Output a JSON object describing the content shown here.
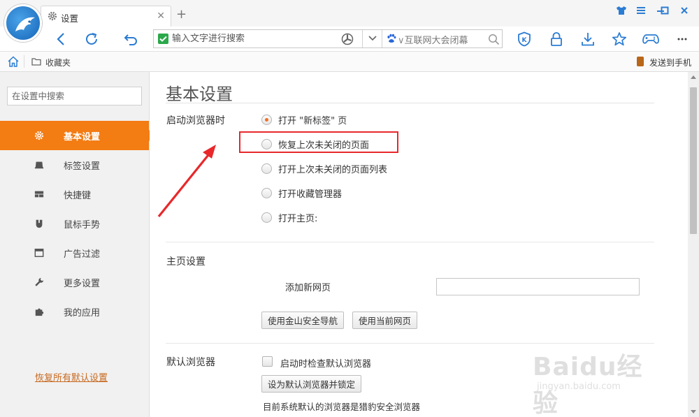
{
  "tab": {
    "title": "设置"
  },
  "window": {
    "shirt_icon": "skin-icon",
    "menu_icon": "menu-icon"
  },
  "address": {
    "placeholder": "输入文字进行搜索",
    "hot_search": "互联网大会闭幕"
  },
  "bookmarks": {
    "favorites_label": "收藏夹",
    "send_to_phone": "发送到手机"
  },
  "sidebar": {
    "search_placeholder": "在设置中搜索",
    "items": [
      {
        "label": "基本设置",
        "icon": "gear-icon",
        "active": true
      },
      {
        "label": "标签设置",
        "icon": "tab-icon"
      },
      {
        "label": "快捷键",
        "icon": "keyboard-icon"
      },
      {
        "label": "鼠标手势",
        "icon": "mouse-icon"
      },
      {
        "label": "广告过滤",
        "icon": "window-icon"
      },
      {
        "label": "更多设置",
        "icon": "wrench-icon"
      },
      {
        "label": "我的应用",
        "icon": "puzzle-icon"
      }
    ],
    "reset_link": "恢复所有默认设置"
  },
  "main": {
    "title": "基本设置",
    "startup": {
      "label": "启动浏览器时",
      "options": [
        {
          "label": "打开 \"新标签\" 页",
          "checked": true
        },
        {
          "label": "恢复上次未关闭的页面",
          "checked": false
        },
        {
          "label": "打开上次未关闭的页面列表",
          "checked": false
        },
        {
          "label": "打开收藏管理器",
          "checked": false
        },
        {
          "label": "打开主页:",
          "checked": false
        }
      ]
    },
    "homepage": {
      "label": "主页设置",
      "add_label": "添加新网页",
      "btn_safe_nav": "使用金山安全导航",
      "btn_current": "使用当前网页"
    },
    "default_browser": {
      "label": "默认浏览器",
      "check_label": "启动时检查默认浏览器",
      "btn_set": "设为默认浏览器并锁定",
      "status": "目前系统默认的浏览器是猎豹安全浏览器"
    }
  },
  "watermark": {
    "brand": "Baidu经验",
    "url": "jingyan.baidu.com"
  },
  "colors": {
    "accent": "#f37c13",
    "highlight": "#e8282b",
    "link": "#c86a20"
  }
}
